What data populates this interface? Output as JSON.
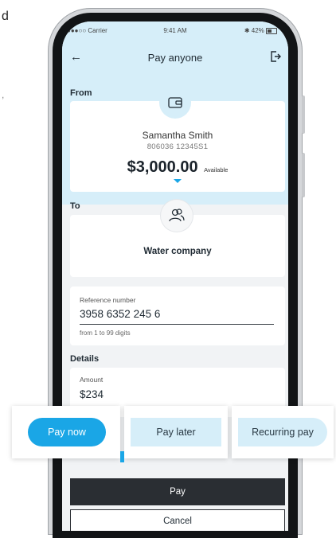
{
  "edge": {
    "letter": "d",
    "mark": ","
  },
  "status_bar": {
    "carrier": "●●●○○ Carrier",
    "time": "9:41 AM",
    "battery": "42%"
  },
  "nav": {
    "title": "Pay anyone"
  },
  "from": {
    "label": "From",
    "name": "Samantha Smith",
    "account": "806036 12345S1",
    "balance": "$3,000.00",
    "balance_suffix": "Available"
  },
  "to": {
    "label": "To",
    "name": "Water company"
  },
  "reference": {
    "label": "Reference number",
    "value": "3958 6352 245 6",
    "hint": "from 1 to 99 digits"
  },
  "details": {
    "label": "Details",
    "amount_label": "Amount",
    "amount_value": "$234"
  },
  "options": {
    "pay_now": "Pay now",
    "pay_later": "Pay later",
    "recurring": "Recurring pay",
    "selected": "Pay now",
    "accent": "#1aa6e6"
  },
  "actions": {
    "pay": "Pay",
    "cancel": "Cancel"
  }
}
